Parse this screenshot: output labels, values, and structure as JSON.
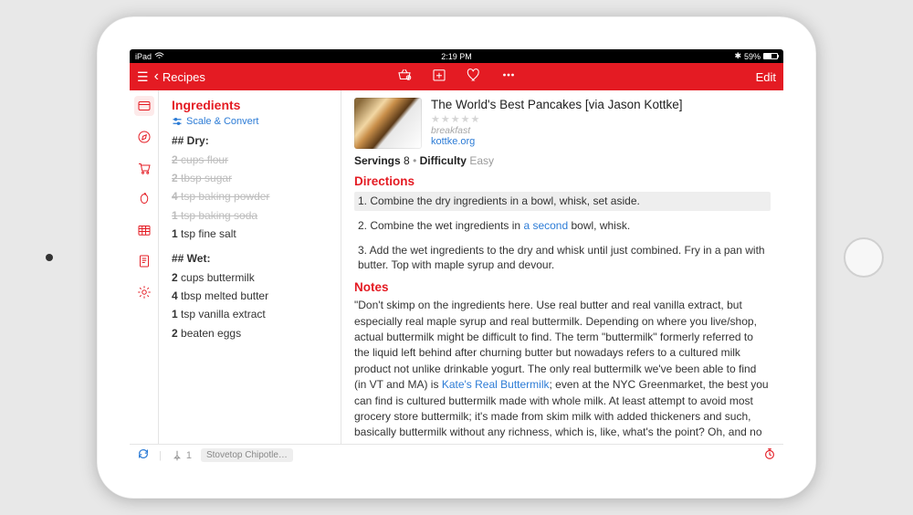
{
  "status": {
    "carrier": "iPad",
    "time": "2:19 PM",
    "battery": "59%"
  },
  "nav": {
    "back": "Recipes",
    "edit": "Edit"
  },
  "ingredients": {
    "title": "Ingredients",
    "scale_label": "Scale & Convert",
    "dry_label": "## Dry:",
    "wet_label": "## Wet:",
    "dry": [
      {
        "amt": "2",
        "text": "cups flour",
        "done": true
      },
      {
        "amt": "2",
        "text": "tbsp sugar",
        "done": true
      },
      {
        "amt": "4",
        "text": "tsp baking powder",
        "done": true
      },
      {
        "amt": "1",
        "text": "tsp baking soda",
        "done": true
      },
      {
        "amt": "1",
        "text": "tsp fine salt",
        "done": false
      }
    ],
    "wet": [
      {
        "amt": "2",
        "text": "cups buttermilk",
        "done": false
      },
      {
        "amt": "4",
        "text": "tbsp melted butter",
        "done": false
      },
      {
        "amt": "1",
        "text": "tsp vanilla extract",
        "done": false
      },
      {
        "amt": "2",
        "text": "beaten eggs",
        "done": false
      }
    ]
  },
  "recipe": {
    "title": "The World's Best Pancakes [via Jason Kottke]",
    "meal": "breakfast",
    "source": "kottke.org",
    "servings_label": "Servings",
    "servings_value": "8",
    "difficulty_label": "Difficulty",
    "difficulty_value": "Easy"
  },
  "directions": {
    "title": "Directions",
    "steps": [
      "1. Combine the dry ingredients in a bowl, whisk, set aside.",
      "2. Combine the wet ingredients in a second bowl, whisk.",
      "3. Add the wet ingredients to the dry and whisk until just combined. Fry in a pan with butter. Top with maple syrup and devour."
    ],
    "step2_pre": "2. Combine the wet ingredients in ",
    "step2_link": "a second",
    "step2_post": " bowl, whisk."
  },
  "notes": {
    "title": "Notes",
    "pre": "\"Don't skimp on the ingredients here. Use real butter and real vanilla extract, but especially real maple syrup and real buttermilk. Depending on where you live/shop, actual buttermilk might be difficult to find. The term \"buttermilk\" formerly referred to the liquid left behind after churning butter but nowadays refers to a cultured milk product not unlike drinkable yogurt. The only real buttermilk we've been able to find (in VT and MA) is ",
    "link": "Kate's Real Buttermilk",
    "post": "; even at the NYC Greenmarket, the best you can find is cultured buttermilk made with whole milk. At least attempt to avoid most grocery store buttermilk; it's made from skim milk with added thickeners and such, basically buttermilk without any richness, which is, like, what's the point? Oh, and no powdered buttermilk either…it messes with the texture too much. The point is, these are buttermilk pancakes and they taste best with the best"
  },
  "footer": {
    "pin_count": "1",
    "chip": "Stovetop Chipotle…"
  }
}
